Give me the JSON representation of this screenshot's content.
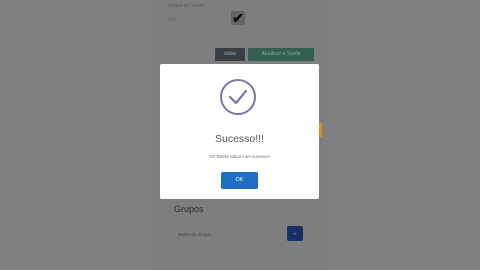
{
  "form": {
    "label": "Status da Tarefa",
    "field_value": "Sim",
    "checkbox_checked": true,
    "back_label": "Voltar",
    "save_label": "Atualizar a Tarefa"
  },
  "section": {
    "title": "Grupos",
    "item_label": "Nome do Grupo"
  },
  "dialog": {
    "title": "Sucesso!!!",
    "message": "Ol! Tarefa Salva com sucesso!",
    "ok_label": "OK",
    "icon": "check-circle-icon"
  },
  "colors": {
    "ok_button": "#1e6fc2",
    "check_icon": "#7b77ad",
    "toast_accent": "#e08a26"
  }
}
